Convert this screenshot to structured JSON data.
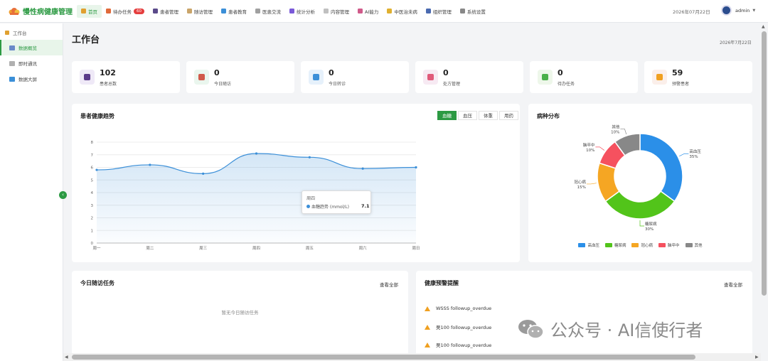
{
  "app": {
    "title": "慢性病健康管理"
  },
  "nav": [
    {
      "label": "首页",
      "icon": "home-icon",
      "color": "#e0a030",
      "active": true
    },
    {
      "label": "待办任务",
      "icon": "task-icon",
      "color": "#e06a3a",
      "badge": "60"
    },
    {
      "label": "患者管理",
      "icon": "user-icon",
      "color": "#5b4a8a"
    },
    {
      "label": "随访管理",
      "icon": "clipboard-icon",
      "color": "#caa56a"
    },
    {
      "label": "患者教育",
      "icon": "book-icon",
      "color": "#3b8fd8"
    },
    {
      "label": "医患交流",
      "icon": "chat-icon",
      "color": "#a0a0a0"
    },
    {
      "label": "统计分析",
      "icon": "chart-icon",
      "color": "#7a5ad8"
    },
    {
      "label": "内容管理",
      "icon": "file-icon",
      "color": "#c0c0c0"
    },
    {
      "label": "AI能力",
      "icon": "ai-icon",
      "color": "#d05a8a"
    },
    {
      "label": "中医治未病",
      "icon": "herb-icon",
      "color": "#e0b030"
    },
    {
      "label": "组织管理",
      "icon": "org-icon",
      "color": "#4a6ab0"
    },
    {
      "label": "系统设置",
      "icon": "gear-icon",
      "color": "#888888"
    }
  ],
  "header": {
    "date": "2026年07月22日",
    "user": "admin"
  },
  "sidebar": {
    "group": "工作台",
    "items": [
      {
        "label": "数据概览",
        "icon": "dashboard-icon",
        "color": "#6a8ac8",
        "active": true
      },
      {
        "label": "即时通讯",
        "icon": "message-icon",
        "color": "#b0b0b0"
      },
      {
        "label": "数据大屏",
        "icon": "monitor-icon",
        "color": "#3b8fd8"
      }
    ]
  },
  "page": {
    "title": "工作台",
    "date": "2026年7月22日"
  },
  "stats": [
    {
      "value": "102",
      "label": "患者总数",
      "icon": "patient-icon",
      "bg": "#efe9f7",
      "fg": "#5b3a8a"
    },
    {
      "value": "0",
      "label": "今日随访",
      "icon": "clipboard-icon",
      "bg": "#eaf6ee",
      "fg": "#d05a4a"
    },
    {
      "value": "0",
      "label": "今日转诊",
      "icon": "refresh-icon",
      "bg": "#e6f1fb",
      "fg": "#3b8fd8"
    },
    {
      "value": "0",
      "label": "处方管理",
      "icon": "pill-icon",
      "bg": "#f7eaf3",
      "fg": "#e05a7a"
    },
    {
      "value": "0",
      "label": "待办任务",
      "icon": "check-icon",
      "bg": "#eef7ea",
      "fg": "#4ab04a"
    },
    {
      "value": "59",
      "label": "预警患者",
      "icon": "warning-icon",
      "bg": "#fbefea",
      "fg": "#f0a020"
    }
  ],
  "trend": {
    "title": "患者健康趋势",
    "tabs": [
      "血糖",
      "血压",
      "体重",
      "用药"
    ],
    "active_tab": "血糖",
    "tooltip": {
      "title": "周四",
      "name": "血糖趋势 (mmol/L)",
      "value": "7.1"
    }
  },
  "chart_data": [
    {
      "type": "line",
      "x": [
        "周一",
        "周二",
        "周三",
        "周四",
        "周五",
        "周六",
        "周日"
      ],
      "series": [
        {
          "name": "血糖趋势 (mmol/L)",
          "values": [
            5.8,
            6.2,
            5.5,
            7.1,
            6.8,
            5.9,
            6.0
          ],
          "color": "#3b8fd8"
        }
      ],
      "ylim": [
        0,
        8
      ],
      "yticks": [
        0,
        1,
        2,
        3,
        4,
        5,
        6,
        7,
        8
      ],
      "grid": true,
      "area": true
    },
    {
      "type": "pie",
      "donut": true,
      "title": "病种分布",
      "labels": [
        "高血压",
        "糖尿病",
        "冠心病",
        "脑卒中",
        "其他"
      ],
      "values": [
        35,
        30,
        15,
        10,
        10
      ],
      "colors": [
        "#2b8fe8",
        "#52c41a",
        "#f5a623",
        "#f5515f",
        "#888888"
      ],
      "legend": "bottom"
    }
  ],
  "followup": {
    "title": "今日随访任务",
    "view_all": "查看全部",
    "empty": "暂无今日随访任务"
  },
  "alerts": {
    "title": "健康预警提醒",
    "view_all": "查看全部",
    "items": [
      "WSSS followup_overdue",
      "吴100 followup_overdue",
      "吴100 followup_overdue"
    ]
  },
  "watermark": {
    "text": "公众号 · AI信使行者"
  }
}
